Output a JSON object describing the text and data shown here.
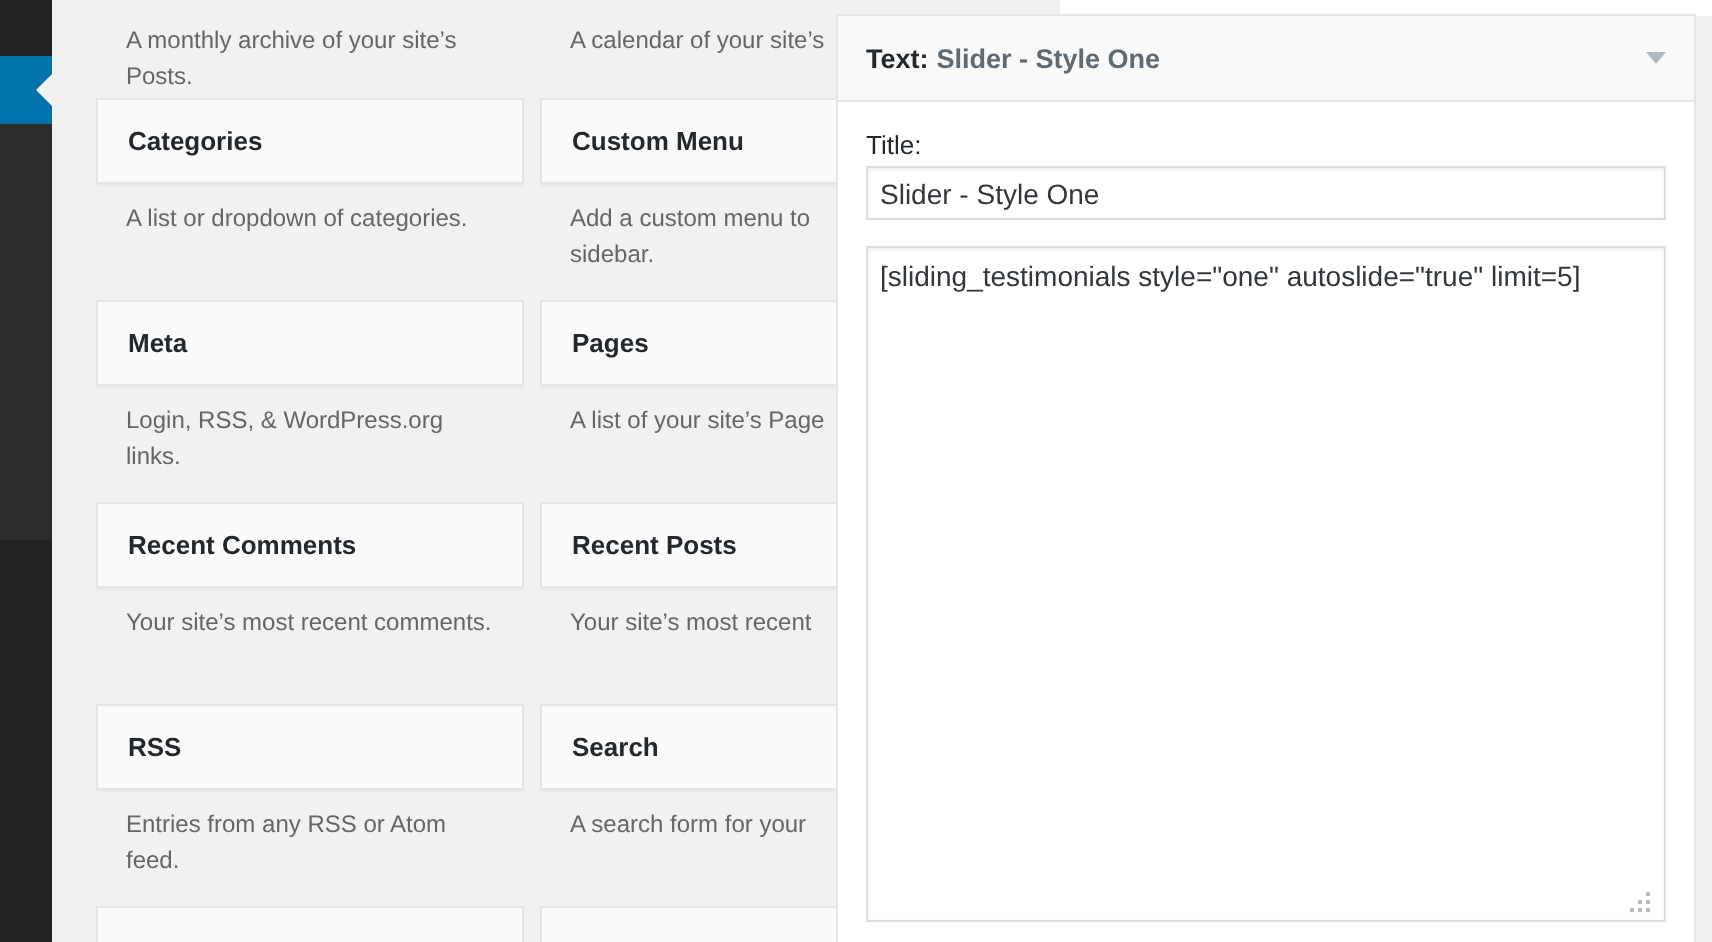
{
  "widgets": [
    {
      "kind": "description_only",
      "description": "A monthly archive of your site’s Posts."
    },
    {
      "kind": "description_only",
      "description": "A calendar of your site’s"
    },
    {
      "kind": "card",
      "title": "Categories",
      "description": "A list or dropdown of categories."
    },
    {
      "kind": "card",
      "title": "Custom Menu",
      "description": "Add a custom menu to\nsidebar."
    },
    {
      "kind": "card",
      "title": "Meta",
      "description": "Login, RSS, & WordPress.org links."
    },
    {
      "kind": "card",
      "title": "Pages",
      "description": "A list of your site’s Page"
    },
    {
      "kind": "card",
      "title": "Recent Comments",
      "description": "Your site’s most recent comments."
    },
    {
      "kind": "card",
      "title": "Recent Posts",
      "description": "Your site’s most recent"
    },
    {
      "kind": "card",
      "title": "RSS",
      "description": "Entries from any RSS or Atom feed."
    },
    {
      "kind": "card",
      "title": "Search",
      "description": "A search form for your"
    },
    {
      "kind": "empty_card"
    },
    {
      "kind": "empty_card"
    }
  ],
  "widget_panel": {
    "type_label": "Text:",
    "name": "Slider - Style One",
    "expanded": true,
    "title_label": "Title:",
    "title_value": "Slider - Style One",
    "content": "[sliding_testimonials style=\"one\" autoslide=\"true\" limit=5]"
  }
}
